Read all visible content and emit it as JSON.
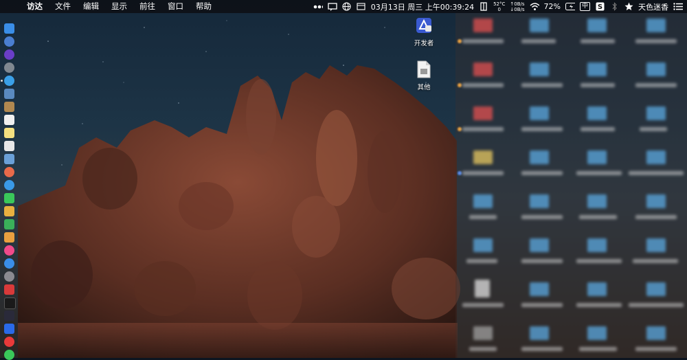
{
  "menubar": {
    "app_name": "访达",
    "items": [
      "文件",
      "编辑",
      "显示",
      "前往",
      "窗口",
      "帮助"
    ],
    "clock": "03月13日 周三 上午00:39:24",
    "temperature": "52°C",
    "temperature_sub": "0",
    "net_up": "↑0B/s",
    "net_down": "↓0B/s",
    "battery": "72%",
    "input_method": "中",
    "user": "天色迷香"
  },
  "desktop": {
    "icons": [
      {
        "label": "开发者",
        "icon": "developer-app-icon"
      },
      {
        "label": "其他",
        "icon": "document-icon"
      }
    ]
  },
  "colors": {
    "menubar_bg": "#0c0e12",
    "folder_blue": "#5aa8e0",
    "folder_red": "#e25050",
    "folder_yellow": "#e8c860"
  }
}
